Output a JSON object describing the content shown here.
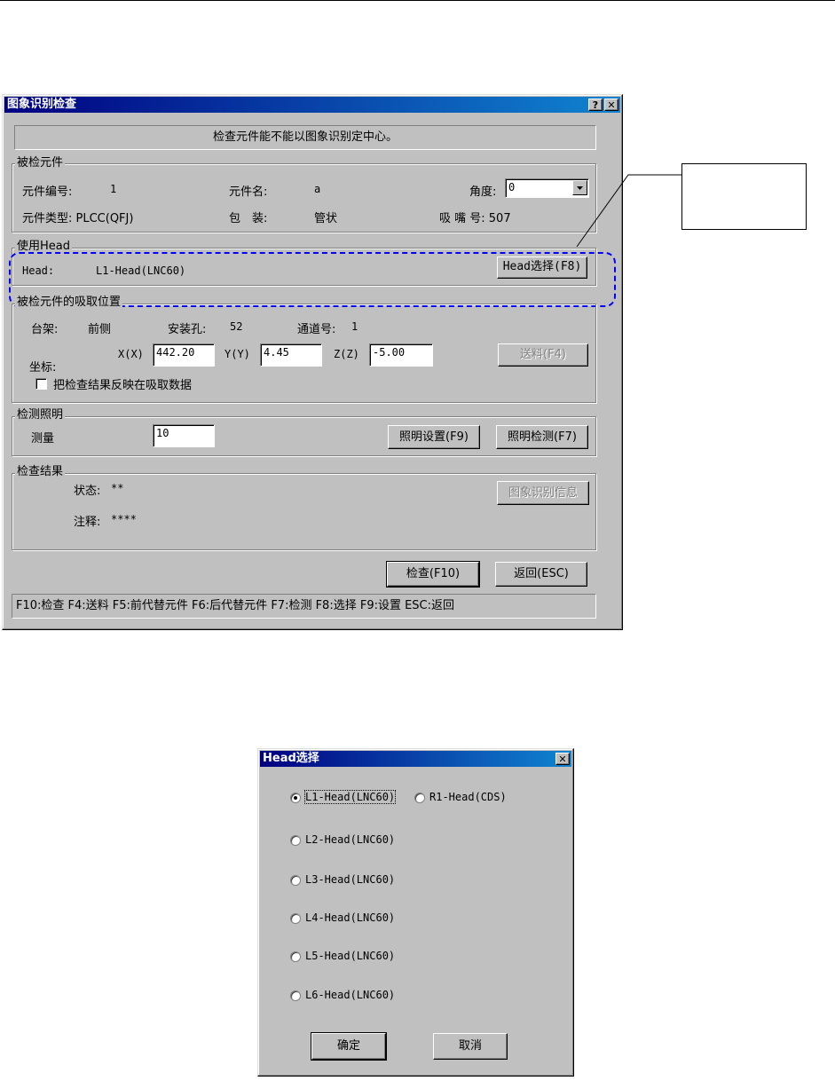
{
  "dialog1": {
    "title": "图象识别检查",
    "help_btn": "?",
    "close_btn": "✕",
    "banner": "检查元件能不能以图象识别定中心。",
    "component_group": {
      "label": "被检元件",
      "id_label": "元件编号:",
      "id_value": "1",
      "name_label": "元件名:",
      "name_value": "a",
      "angle_label": "角度:",
      "angle_value": "0",
      "type_label": "元件类型: PLCC(QFJ)",
      "package_label": "包　装:",
      "package_value": "管状",
      "nozzle_label": "吸 嘴 号: 507"
    },
    "head_group": {
      "label": "使用Head",
      "head_label": "Head:",
      "head_value": "L1-Head(LNC60)",
      "select_btn": "Head选择(F8)"
    },
    "pickup_group": {
      "label": "被检元件的吸取位置",
      "rack_label": "台架:",
      "rack_value": "前侧",
      "hole_label": "安装孔:",
      "hole_value": "52",
      "channel_label": "通道号:",
      "channel_value": "1",
      "coord_label": "坐标:",
      "x_label": "X(X)",
      "x_value": "442.20",
      "y_label": "Y(Y)",
      "y_value": "4.45",
      "z_label": "Z(Z)",
      "z_value": "-5.00",
      "feed_btn": "送料(F4)",
      "reflect_checkbox": "把检查结果反映在吸取数据"
    },
    "light_group": {
      "label": "检测照明",
      "measure_label": "测量",
      "measure_value": "10",
      "setup_btn": "照明设置(F9)",
      "test_btn": "照明检测(F7)"
    },
    "result_group": {
      "label": "检查结果",
      "status_label": "状态:",
      "status_value": "**",
      "note_label": "注释:",
      "note_value": "****",
      "info_btn": "图象识别信息"
    },
    "check_btn": "检查(F10)",
    "back_btn": "返回(ESC)",
    "statusbar": "F10:检查 F4:送料 F5:前代替元件 F6:后代替元件 F7:检测 F8:选择 F9:设置 ESC:返回"
  },
  "dialog2": {
    "title": "Head选择",
    "close_btn": "✕",
    "options": [
      {
        "label": "L1-Head(LNC60)",
        "selected": true
      },
      {
        "label": "R1-Head(CDS)",
        "selected": false
      },
      {
        "label": "L2-Head(LNC60)",
        "selected": false
      },
      {
        "label": "L3-Head(LNC60)",
        "selected": false
      },
      {
        "label": "L4-Head(LNC60)",
        "selected": false
      },
      {
        "label": "L5-Head(LNC60)",
        "selected": false
      },
      {
        "label": "L6-Head(LNC60)",
        "selected": false
      }
    ],
    "ok_btn": "确定",
    "cancel_btn": "取消"
  }
}
